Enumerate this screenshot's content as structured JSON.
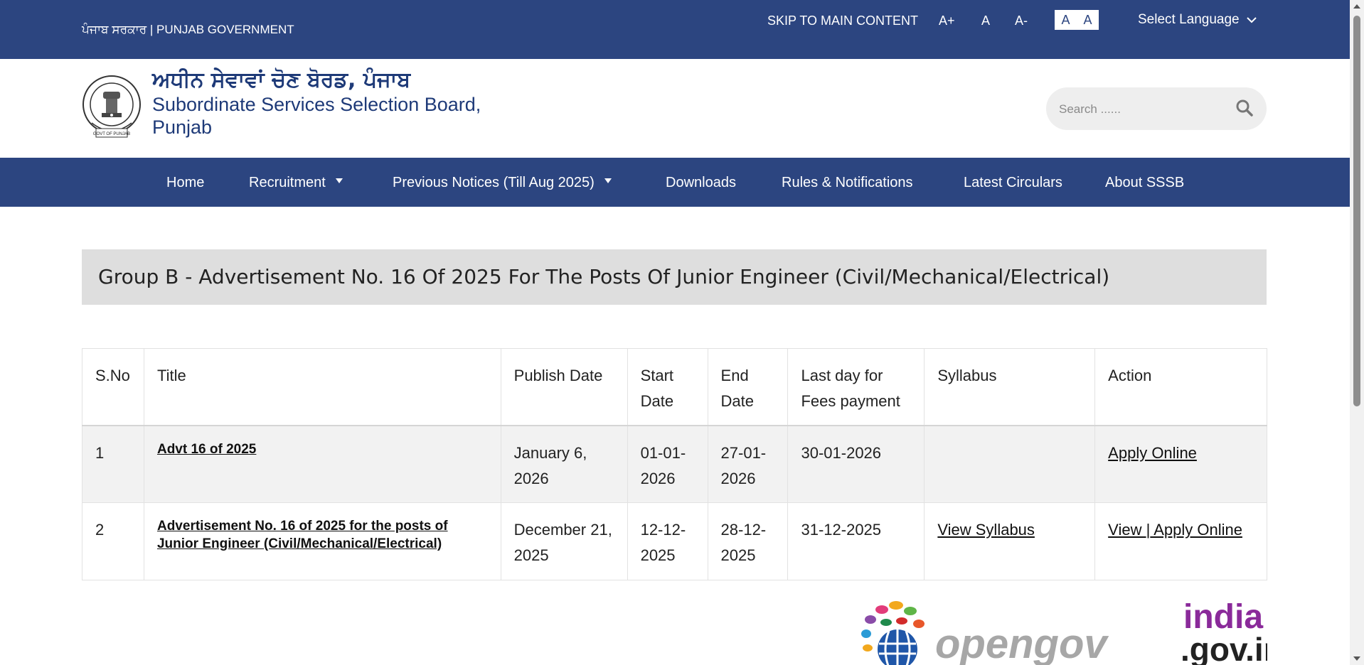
{
  "topbar": {
    "gov_name": "ਪੰਜਾਬ ਸਰਕਾਰ | PUNJAB GOVERNMENT",
    "skip_link": "SKIP TO MAIN CONTENT",
    "font_increase": "A+",
    "font_normal": "A",
    "font_decrease": "A-",
    "contrast_light": "A",
    "contrast_dark": "A",
    "language_label": "Select Language"
  },
  "header": {
    "title_punjabi": "ਅਧੀਨ ਸੇਵਾਵਾਂ ਚੋਣ ਬੋਰਡ, ਪੰਜਾਬ",
    "title_english": "Subordinate Services Selection Board, Punjab",
    "emblem_text": "GOVT OF PUNJAB",
    "search_placeholder": "Search ......"
  },
  "nav": {
    "items": [
      {
        "label": "Home",
        "has_dropdown": false
      },
      {
        "label": "Recruitment",
        "has_dropdown": true
      },
      {
        "label": "Previous Notices (Till Aug 2025)",
        "has_dropdown": true
      },
      {
        "label": "Downloads",
        "has_dropdown": false
      },
      {
        "label": "Rules & Notifications",
        "has_dropdown": false
      },
      {
        "label": "Latest Circulars",
        "has_dropdown": false
      },
      {
        "label": "About SSSB",
        "has_dropdown": false
      }
    ]
  },
  "main": {
    "heading": "Group B - Advertisement No. 16 Of 2025 For The Posts Of Junior Engineer (Civil/Mechanical/Electrical)",
    "table": {
      "columns": [
        "S.No",
        "Title",
        "Publish Date",
        "Start Date",
        "End Date",
        "Last day for Fees payment",
        "Syllabus",
        "Action"
      ],
      "rows": [
        {
          "sno": "1",
          "title": "Advt 16 of 2025",
          "publish_date": "January 6, 2026",
          "start_date": "01-01-2026",
          "end_date": "27-01-2026",
          "last_fee_day": "30-01-2026",
          "syllabus": "",
          "action_view": "",
          "action_separator": "",
          "action_apply": "Apply Online"
        },
        {
          "sno": "2",
          "title": "Advertisement No. 16 of 2025 for the posts of Junior Engineer (Civil/Mechanical/Electrical)",
          "publish_date": "December 21, 2025",
          "start_date": "12-12-2025",
          "end_date": "28-12-2025",
          "last_fee_day": "31-12-2025",
          "syllabus": "View Syllabus",
          "action_view": "View ",
          "action_separator": "|",
          "action_apply": " Apply Online"
        }
      ]
    }
  },
  "footer": {
    "logo_opengov": "opengov",
    "logo_indiagov_line1": "india",
    "logo_indiagov_line2": ".gov.in"
  },
  "colors": {
    "brand_blue": "#2c4580",
    "title_blue": "#1e3a78",
    "heading_bg": "#dedede",
    "row_alt_bg": "#f2f2f2"
  }
}
